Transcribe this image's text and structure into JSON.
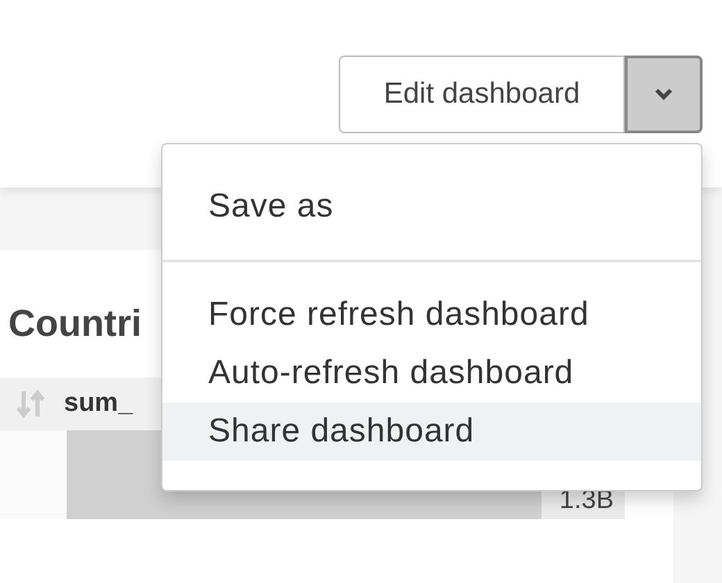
{
  "header": {
    "edit_button": "Edit dashboard"
  },
  "chart": {
    "title": "Countri",
    "column": "sum_",
    "rows": [
      {
        "value": "1.3B",
        "level": 0.85
      }
    ]
  },
  "menu": {
    "items": [
      {
        "label": "Save as",
        "kind": "item",
        "selected": false
      },
      {
        "kind": "divider"
      },
      {
        "label": "Force refresh dashboard",
        "kind": "item",
        "selected": false
      },
      {
        "label": "Auto-refresh dashboard",
        "kind": "item",
        "selected": false
      },
      {
        "label": "Share dashboard",
        "kind": "item",
        "selected": true
      }
    ]
  }
}
